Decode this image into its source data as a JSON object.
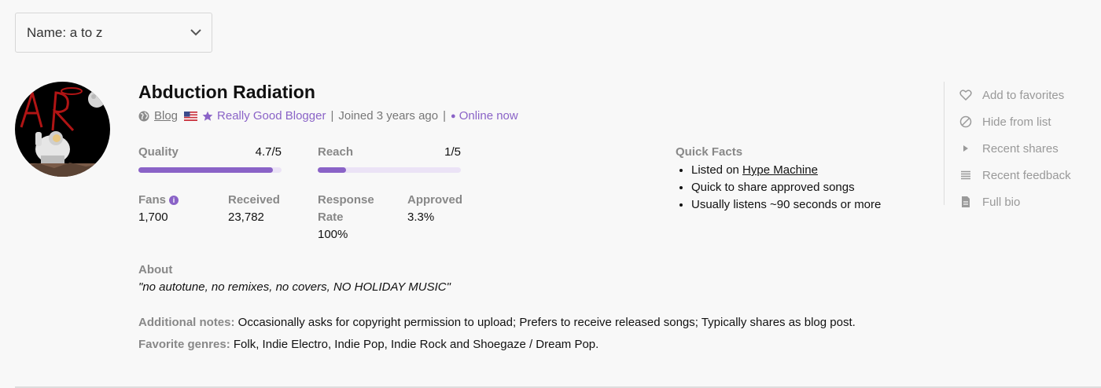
{
  "sort": {
    "label": "Name: a to z",
    "icon": "chevron-down-icon"
  },
  "curator": {
    "name": "Abduction Radiation",
    "avatar_letters": "AR",
    "type_label": "Blog",
    "country_flag": "US",
    "badge": "Really Good Blogger",
    "joined": "Joined 3 years ago",
    "separator": "|",
    "status": "Online now"
  },
  "stats": {
    "quality": {
      "label": "Quality",
      "value": "4.7/5",
      "fill_fraction": 0.94
    },
    "reach": {
      "label": "Reach",
      "value": "1/5",
      "fill_fraction": 0.2
    },
    "fans": {
      "label": "Fans",
      "value": "1,700",
      "info": "i"
    },
    "received": {
      "label": "Received",
      "value": "23,782"
    },
    "response_rate": {
      "label_line1": "Response",
      "label_line2": "Rate",
      "value": "100%"
    },
    "approved": {
      "label": "Approved",
      "value": "3.3%"
    }
  },
  "quick_facts": {
    "title": "Quick Facts",
    "listed_on_prefix": "Listed on ",
    "listed_on_link": "Hype Machine",
    "items": [
      "Quick to share approved songs",
      "Usually listens ~90 seconds or more"
    ]
  },
  "actions": [
    {
      "label": "Add to favorites",
      "icon": "heart-icon"
    },
    {
      "label": "Hide from list",
      "icon": "block-icon"
    },
    {
      "label": "Recent shares",
      "icon": "play-icon"
    },
    {
      "label": "Recent feedback",
      "icon": "lines-icon"
    },
    {
      "label": "Full bio",
      "icon": "document-icon"
    }
  ],
  "about": {
    "label": "About",
    "text": "\"no autotune, no remixes, no covers, NO HOLIDAY MUSIC\""
  },
  "additional_notes": {
    "label": "Additional notes:",
    "text": " Occasionally asks for copyright permission to upload; Prefers to receive released songs; Typically shares as blog post."
  },
  "favorite_genres": {
    "label": "Favorite genres:",
    "text": " Folk, Indie Electro, Indie Pop, Indie Rock and Shoegaze / Dream Pop."
  },
  "colors": {
    "accent": "#8a63c7",
    "bar_track": "#ebe3f6",
    "muted": "#888888"
  }
}
